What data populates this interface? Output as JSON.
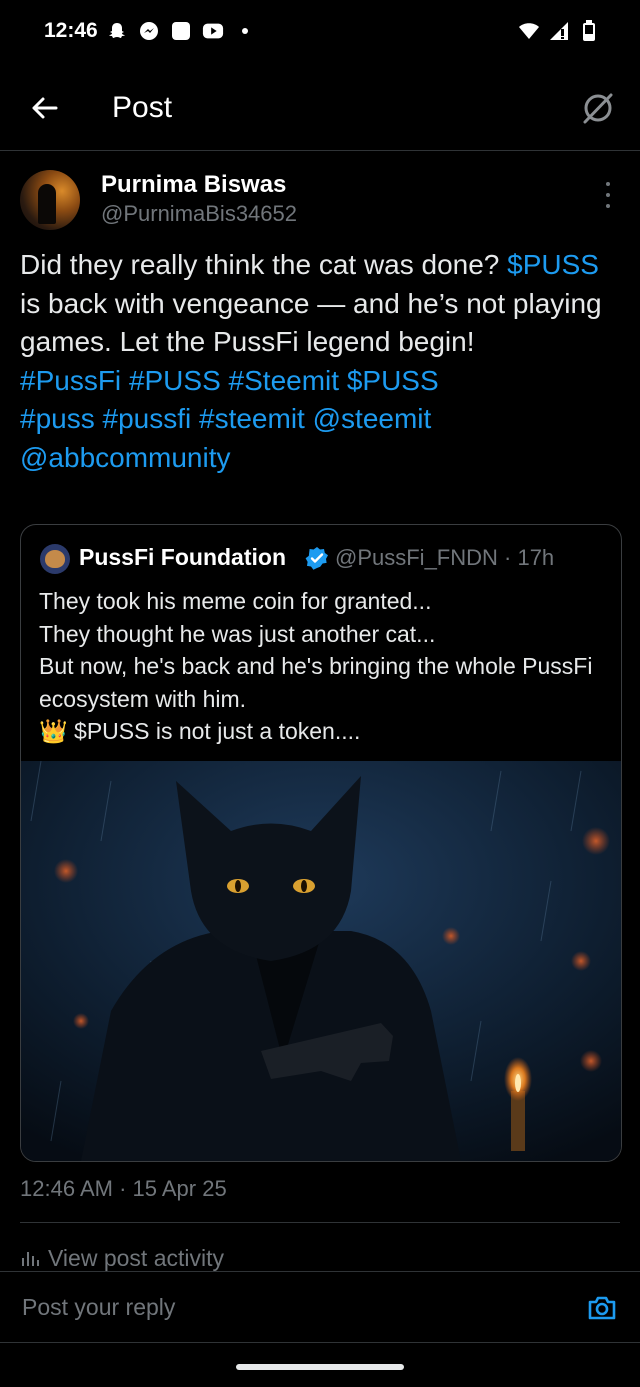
{
  "status_bar": {
    "time": "12:46",
    "left_icons": [
      "snapchat-icon",
      "messenger-icon",
      "square-icon",
      "youtube-icon",
      "dot-icon"
    ],
    "right_icons": [
      "wifi-icon",
      "signal-icon",
      "battery-icon"
    ]
  },
  "header": {
    "title": "Post"
  },
  "post": {
    "author_name": "Purnima Biswas",
    "author_handle": "@PurnimaBis34652",
    "text_parts": {
      "p1": "Did they really think the cat was done? ",
      "cashtag": "$PUSS",
      "p2": " is back with vengeance — and he’s not playing games. Let the PussFi legend begin!",
      "tag1": "#PussFi",
      "tag2": "#PUSS",
      "tag3": "#Steemit",
      "tag4": "$PUSS",
      "tag5": "#puss",
      "tag6": "#pussfi",
      "tag7": "#steemit",
      "mention1": "@steemit",
      "mention2": "@abbcommunity"
    },
    "timestamp": "12:46 AM · 15 Apr 25"
  },
  "quote": {
    "name": "PussFi Foundation",
    "handle_time": "@PussFi_FNDN · 17h",
    "lines": [
      "They took his meme coin for granted...",
      "They thought he was just another cat...",
      "But now, he's back and he's bringing the whole PussFi ecosystem with him.",
      "$PUSS is not just a token...."
    ],
    "crown_emoji": "👑"
  },
  "activity": {
    "label": "View post activity"
  },
  "reply": {
    "placeholder": "Post your reply"
  },
  "colors": {
    "accent": "#1d9bf0",
    "muted": "#71767b",
    "text": "#e7e9ea",
    "background": "#000000"
  }
}
